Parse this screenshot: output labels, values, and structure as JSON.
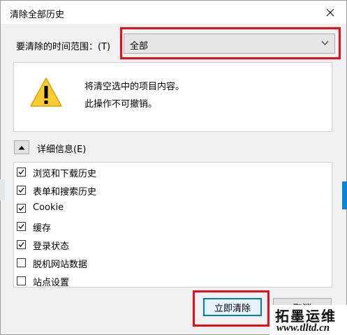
{
  "window": {
    "title": "清除全部历史",
    "close_icon": "close-icon"
  },
  "range": {
    "label": "要清除的时间范围：(T)",
    "selected": "全部"
  },
  "warning": {
    "icon": "warning-icon",
    "line1": "将清空选中的项目内容。",
    "line2": "此操作不可撤销。"
  },
  "details": {
    "label": "详细信息(E)",
    "expanded": true
  },
  "items": [
    {
      "label": "浏览和下载历史",
      "checked": true
    },
    {
      "label": "表单和搜索历史",
      "checked": true
    },
    {
      "label": "Cookie",
      "checked": true
    },
    {
      "label": "缓存",
      "checked": true
    },
    {
      "label": "登录状态",
      "checked": true
    },
    {
      "label": "脱机网站数据",
      "checked": false
    },
    {
      "label": "站点设置",
      "checked": false
    }
  ],
  "buttons": {
    "clear_now": "立即清除",
    "cancel": "取消"
  },
  "watermark": {
    "top": "拓墨运维",
    "bottom": "www.tlltd.cn"
  },
  "colors": {
    "highlight": "#e3101c",
    "accent": "#0078d7"
  }
}
